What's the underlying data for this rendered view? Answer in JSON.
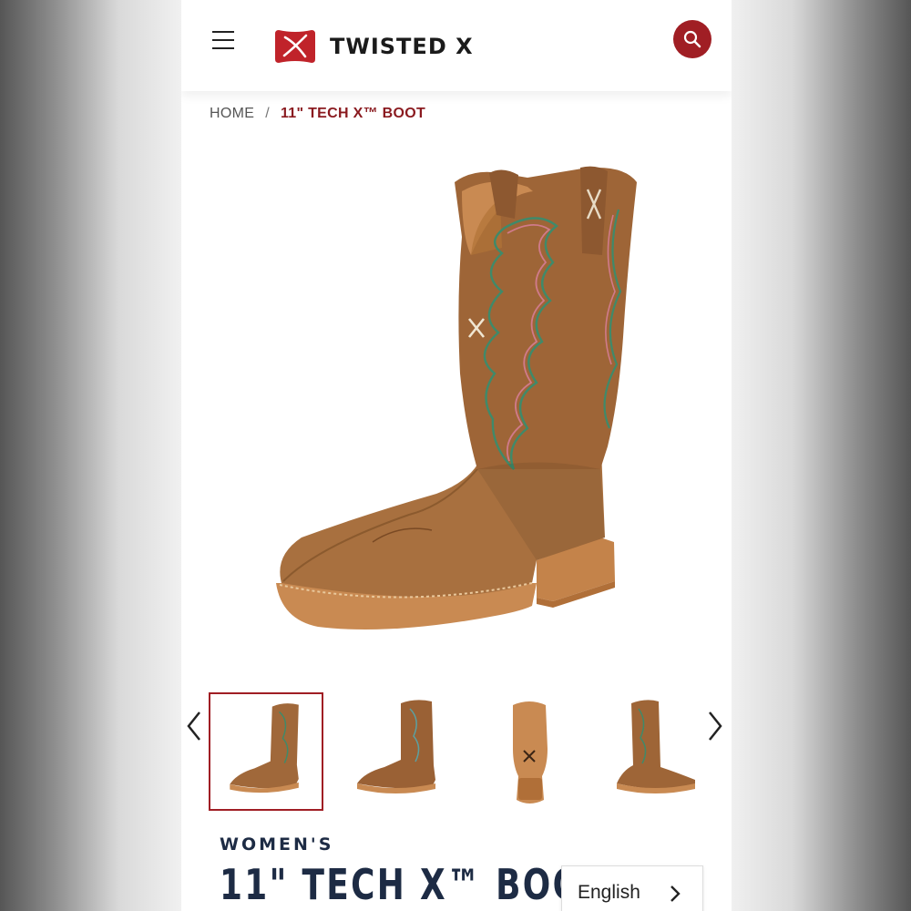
{
  "header": {
    "menu_icon": "hamburger-menu-icon",
    "logo_text": "TWISTED X",
    "logo_mark_color": "#c0232a",
    "search_icon": "search-icon",
    "accent": "#a01e24"
  },
  "breadcrumb": {
    "home": "HOME",
    "separator": "/",
    "current": "11\" TECH X™ BOOT"
  },
  "gallery": {
    "main_image": "boot-side-view",
    "thumbnails": [
      {
        "view": "side-view",
        "active": true
      },
      {
        "view": "outer-side-view",
        "active": false
      },
      {
        "view": "sole-view",
        "active": false
      },
      {
        "view": "back-side-view",
        "active": false
      }
    ],
    "prev_icon": "chevron-left-icon",
    "next_icon": "chevron-right-icon"
  },
  "product": {
    "category": "WOMEN'S",
    "title": "11\" TECH X™ BOOT"
  },
  "language": {
    "label": "English",
    "icon": "chevron-right-icon"
  }
}
